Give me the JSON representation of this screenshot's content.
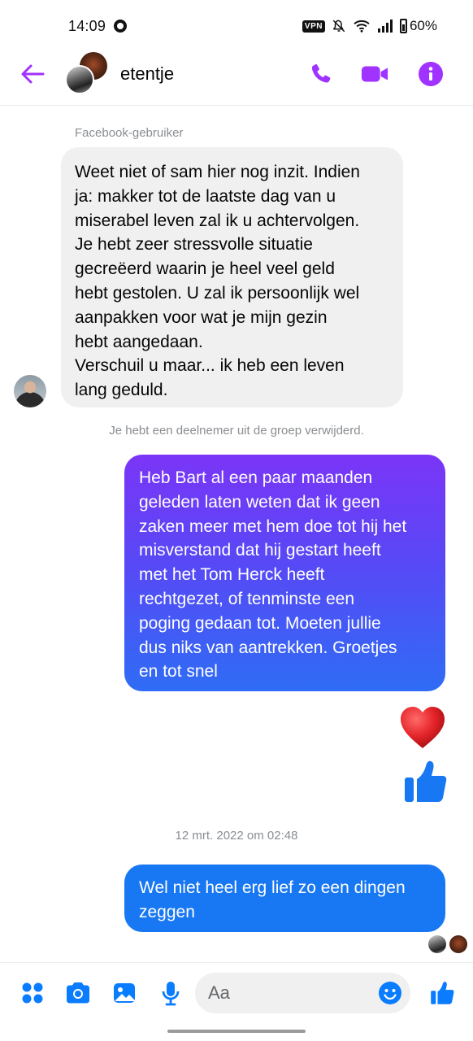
{
  "status_bar": {
    "time": "14:09",
    "vpn": "VPN",
    "battery": "60%",
    "icons": [
      "app-notification-icon",
      "mute-icon",
      "wifi-icon",
      "signal-icon",
      "battery-icon"
    ]
  },
  "header": {
    "title": "etentje",
    "icons": [
      "back-arrow-icon",
      "phone-icon",
      "video-icon",
      "info-icon"
    ],
    "accent_color": "#a033ff"
  },
  "messages": {
    "sender_name": "Facebook-gebruiker",
    "incoming_text": "Weet niet of sam hier nog inzit. Indien\nja: makker tot de laatste dag van u\nmiserabel leven zal ik u achtervolgen.\nJe hebt zeer stressvolle situatie\ngecreëerd waarin je heel veel geld\nhebt gestolen. U zal ik persoonlijk wel\naanpakken voor wat je mijn gezin\nhebt aangedaan.\nVerschuil u maar... ik heb een leven\nlang geduld.",
    "system_note": "Je hebt een deelnemer uit de groep verwijderd.",
    "outgoing_text_1": "Heb Bart al een paar maanden\ngeleden laten weten dat ik geen\nzaken meer met hem doe tot hij het\nmisverstand dat hij gestart heeft\nmet het Tom Herck heeft\nrechtgezet, of tenminste een\npoging gedaan tot. Moeten jullie\ndus niks van aantrekken. Groetjes\nen tot snel",
    "reactions": [
      "heart-emoji",
      "thumbs-up-icon"
    ],
    "timestamp": "12 mrt. 2022 om 02:48",
    "outgoing_text_2": "Wel niet heel erg lief zo een dingen\nzeggen",
    "incoming_bubble_color": "#f0f0f0",
    "outgoing_color": "#1877f2"
  },
  "composer": {
    "placeholder": "Aa",
    "icons": [
      "apps-icon",
      "camera-icon",
      "gallery-icon",
      "microphone-icon",
      "emoji-icon",
      "thumbs-up-icon"
    ],
    "icon_color": "#0a7cff"
  }
}
